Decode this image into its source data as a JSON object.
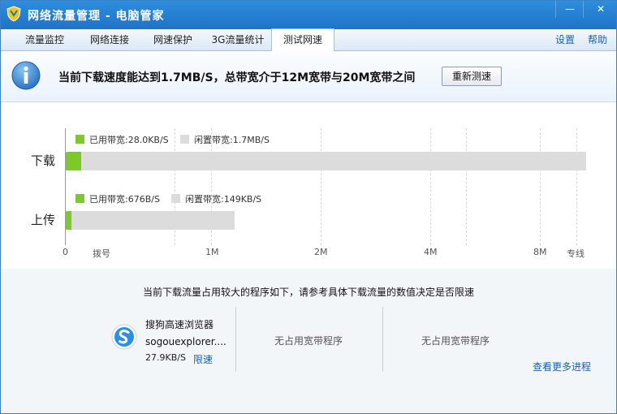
{
  "window": {
    "title": "网络流量管理 - 电脑管家",
    "minimize_glyph": "—",
    "close_glyph": "✕"
  },
  "tabs": [
    {
      "label": "流量监控",
      "active": false
    },
    {
      "label": "网络连接",
      "active": false
    },
    {
      "label": "网速保护",
      "active": false
    },
    {
      "label": "3G流量统计",
      "active": false
    },
    {
      "label": "测试网速",
      "active": true
    }
  ],
  "top_links": {
    "settings": "设置",
    "help": "帮助"
  },
  "info": {
    "message": "当前下载速度能达到1.7MB/S，总带宽介于12M宽带与20M宽带之间",
    "retest_label": "重新测速"
  },
  "chart_data": {
    "type": "bar",
    "orientation": "horizontal",
    "stacked": true,
    "categories": [
      "下载",
      "上传"
    ],
    "x_ticks": [
      "0",
      "拨号",
      "1M",
      "2M",
      "4M",
      "8M",
      "专线"
    ],
    "grid": true,
    "series_labels": {
      "download_used": "已用带宽:28.0KB/S",
      "download_idle": "闲置带宽:1.7MB/S",
      "upload_used": "已用带宽:676B/S",
      "upload_idle": "闲置带宽:149KB/S"
    },
    "download": {
      "used_fraction": 0.03,
      "total_fraction": 1.0
    },
    "upload": {
      "used_fraction": 0.011,
      "total_fraction": 0.325
    }
  },
  "colors": {
    "used": "#7cc928",
    "idle": "#dcdcdc",
    "accent": "#1e73c8"
  },
  "bottom": {
    "title": "当前下载流量占用较大的程序如下，请参考具体下载流量的数值决定是否限速",
    "programs": [
      {
        "icon": "sogou-browser-icon",
        "name": "搜狗高速浏览器",
        "exe": "sogouexplorer....",
        "speed": "27.9KB/S",
        "limit_label": "限速"
      }
    ],
    "empty_slots": [
      "无占用宽带程序",
      "无占用宽带程序"
    ],
    "more_link": "查看更多进程"
  }
}
